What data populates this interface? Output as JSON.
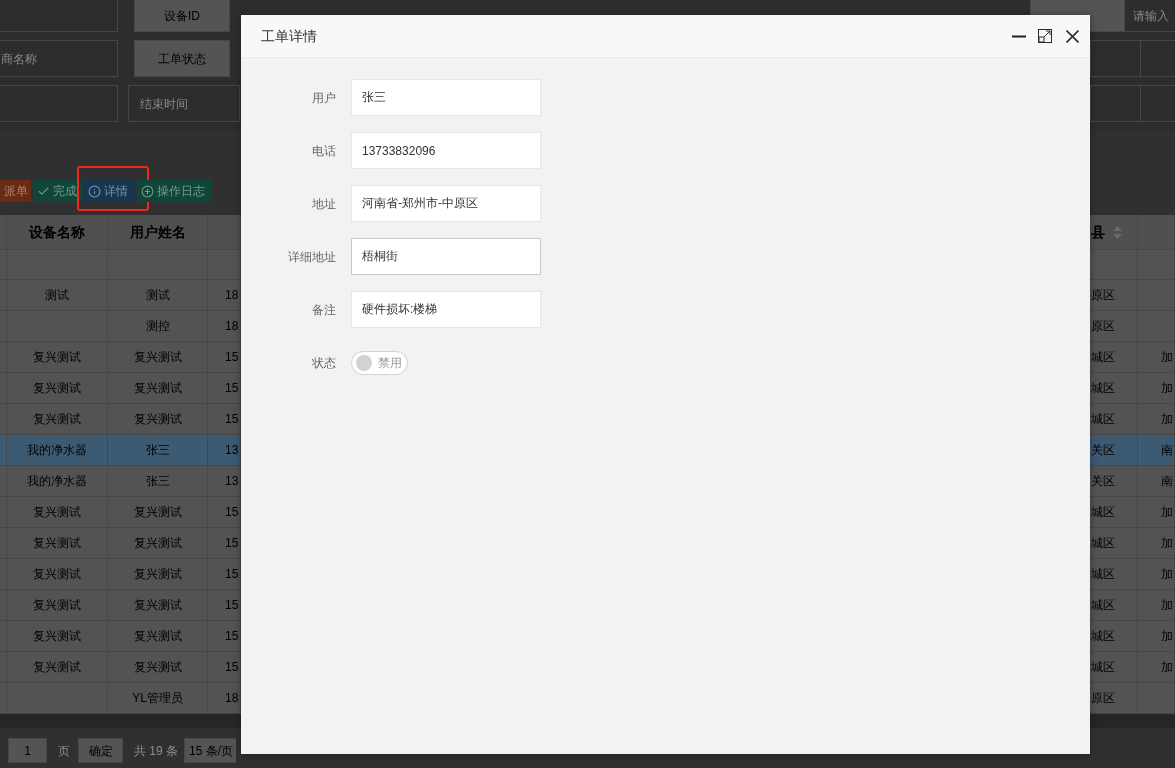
{
  "search_form": {
    "row_1": {
      "label": "设备ID",
      "right_field": {
        "placeholder": "请输入"
      }
    },
    "row_2": {
      "left_field": {
        "placeholder": "商名称"
      },
      "label": "工单状态"
    },
    "row_3": {
      "field": {
        "placeholder": "结束时间"
      }
    }
  },
  "toolbar": {
    "buttons": [
      {
        "kind": "dispatch",
        "label": "派单",
        "highlighted": false
      },
      {
        "kind": "complete",
        "label": "完成",
        "highlighted": false
      },
      {
        "kind": "detail",
        "label": "详情",
        "highlighted": true
      },
      {
        "kind": "log",
        "label": "操作日志",
        "highlighted": false
      }
    ]
  },
  "table": {
    "columns": [
      {
        "label": "设备名称",
        "sortable": false
      },
      {
        "label": "用户姓名",
        "sortable": false
      },
      {
        "label": "县",
        "sortable": true
      }
    ],
    "rows": [
      {
        "device_name": "测试",
        "user_name": "测试",
        "column_3": "18",
        "county": "原区",
        "selected": false
      },
      {
        "user_name": "测控",
        "column_3": "18",
        "county": "原区",
        "selected": false
      },
      {
        "device_name": "复兴测试",
        "user_name": "复兴测试",
        "column_3": "15",
        "county": "城区",
        "column_5": "加",
        "selected": false
      },
      {
        "device_name": "复兴测试",
        "user_name": "复兴测试",
        "column_3": "15",
        "county": "城区",
        "column_5": "加",
        "selected": false
      },
      {
        "device_name": "复兴测试",
        "user_name": "复兴测试",
        "column_3": "15",
        "county": "城区",
        "column_5": "加",
        "selected": false
      },
      {
        "device_name": "我的净水器",
        "user_name": "张三",
        "column_3": "13",
        "county": "关区",
        "column_5": "南",
        "selected": true
      },
      {
        "device_name": "我的净水器",
        "user_name": "张三",
        "column_3": "13",
        "county": "关区",
        "column_5": "南",
        "selected": false
      },
      {
        "device_name": "复兴测试",
        "user_name": "复兴测试",
        "column_3": "15",
        "county": "城区",
        "column_5": "加",
        "selected": false
      },
      {
        "device_name": "复兴测试",
        "user_name": "复兴测试",
        "column_3": "15",
        "county": "城区",
        "column_5": "加",
        "selected": false
      },
      {
        "device_name": "复兴测试",
        "user_name": "复兴测试",
        "column_3": "15",
        "county": "城区",
        "column_5": "加",
        "selected": false
      },
      {
        "device_name": "复兴测试",
        "user_name": "复兴测试",
        "column_3": "15",
        "county": "城区",
        "column_5": "加",
        "selected": false
      },
      {
        "device_name": "复兴测试",
        "user_name": "复兴测试",
        "column_3": "15",
        "county": "城区",
        "column_5": "加",
        "selected": false
      },
      {
        "device_name": "复兴测试",
        "user_name": "复兴测试",
        "column_3": "15",
        "county": "城区",
        "column_5": "加",
        "selected": false
      },
      {
        "user_name": "YL管理员",
        "column_3": "18",
        "county": "原区",
        "selected": false
      }
    ]
  },
  "pagination": {
    "page_input": {
      "value": "1"
    },
    "page_label": "页",
    "confirm_button": "确定",
    "total": "共 19 条",
    "page_size": "15 条/页"
  },
  "dialog": {
    "title": "工单详情",
    "fields": [
      {
        "label": "用户",
        "value": "张三",
        "focused": false
      },
      {
        "label": "电话",
        "value": "13733832096",
        "focused": false
      },
      {
        "label": "地址",
        "value": "河南省-郑州市-中原区",
        "focused": false
      },
      {
        "label": "详细地址",
        "value": "梧桐街",
        "focused": true
      },
      {
        "label": "备注",
        "value": "硬件损坏:楼梯",
        "focused": false
      }
    ],
    "status": {
      "label": "状态",
      "on": false,
      "text": "禁用"
    }
  }
}
